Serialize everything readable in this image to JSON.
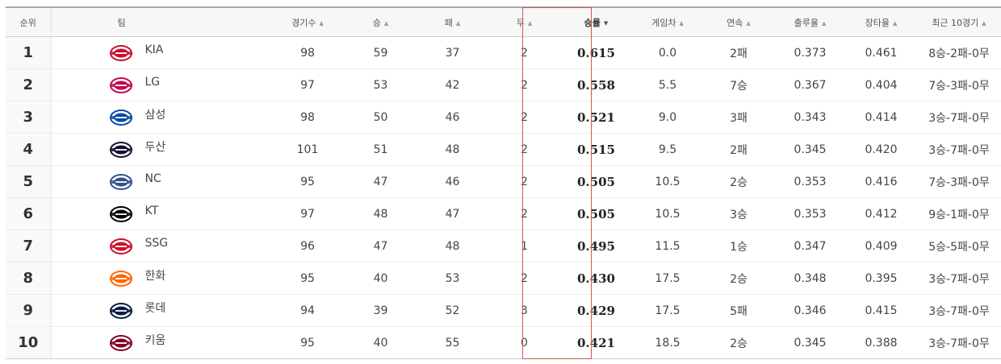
{
  "table": {
    "headers": {
      "rank": "순위",
      "team": "팀",
      "games": "경기수",
      "wins": "승",
      "losses": "패",
      "draws": "무",
      "pct": "승률",
      "gb": "게임차",
      "streak": "연속",
      "obp": "출루율",
      "slg": "장타율",
      "last10": "최근 10경기"
    },
    "sorted_column": "pct",
    "sort_direction": "descending",
    "rows": [
      {
        "rank": "1",
        "team": "KIA",
        "games": "98",
        "wins": "59",
        "losses": "37",
        "draws": "2",
        "pct": "0.615",
        "gb": "0.0",
        "streak": "2패",
        "obp": "0.373",
        "slg": "0.461",
        "last10": "8승-2패-0무",
        "logo_color": "#c8102e"
      },
      {
        "rank": "2",
        "team": "LG",
        "games": "97",
        "wins": "53",
        "losses": "42",
        "draws": "2",
        "pct": "0.558",
        "gb": "5.5",
        "streak": "7승",
        "obp": "0.367",
        "slg": "0.404",
        "last10": "7승-3패-0무",
        "logo_color": "#c30452"
      },
      {
        "rank": "3",
        "team": "삼성",
        "games": "98",
        "wins": "50",
        "losses": "46",
        "draws": "2",
        "pct": "0.521",
        "gb": "9.0",
        "streak": "3패",
        "obp": "0.343",
        "slg": "0.414",
        "last10": "3승-7패-0무",
        "logo_color": "#074ca1"
      },
      {
        "rank": "4",
        "team": "두산",
        "games": "101",
        "wins": "51",
        "losses": "48",
        "draws": "2",
        "pct": "0.515",
        "gb": "9.5",
        "streak": "2패",
        "obp": "0.345",
        "slg": "0.420",
        "last10": "3승-7패-0무",
        "logo_color": "#131230"
      },
      {
        "rank": "5",
        "team": "NC",
        "games": "95",
        "wins": "47",
        "losses": "46",
        "draws": "2",
        "pct": "0.505",
        "gb": "10.5",
        "streak": "2승",
        "obp": "0.353",
        "slg": "0.416",
        "last10": "7승-3패-0무",
        "logo_color": "#315288"
      },
      {
        "rank": "6",
        "team": "KT",
        "games": "97",
        "wins": "48",
        "losses": "47",
        "draws": "2",
        "pct": "0.505",
        "gb": "10.5",
        "streak": "3승",
        "obp": "0.353",
        "slg": "0.412",
        "last10": "9승-1패-0무",
        "logo_color": "#000000"
      },
      {
        "rank": "7",
        "team": "SSG",
        "games": "96",
        "wins": "47",
        "losses": "48",
        "draws": "1",
        "pct": "0.495",
        "gb": "11.5",
        "streak": "1승",
        "obp": "0.347",
        "slg": "0.409",
        "last10": "5승-5패-0무",
        "logo_color": "#ce0e2d"
      },
      {
        "rank": "8",
        "team": "한화",
        "games": "95",
        "wins": "40",
        "losses": "53",
        "draws": "2",
        "pct": "0.430",
        "gb": "17.5",
        "streak": "2승",
        "obp": "0.348",
        "slg": "0.395",
        "last10": "3승-7패-0무",
        "logo_color": "#ff6600"
      },
      {
        "rank": "9",
        "team": "롯데",
        "games": "94",
        "wins": "39",
        "losses": "52",
        "draws": "3",
        "pct": "0.429",
        "gb": "17.5",
        "streak": "5패",
        "obp": "0.346",
        "slg": "0.415",
        "last10": "3승-7패-0무",
        "logo_color": "#041e42"
      },
      {
        "rank": "10",
        "team": "키움",
        "games": "95",
        "wins": "40",
        "losses": "55",
        "draws": "0",
        "pct": "0.421",
        "gb": "18.5",
        "streak": "2승",
        "obp": "0.345",
        "slg": "0.388",
        "last10": "3승-7패-0무",
        "logo_color": "#820024"
      }
    ]
  },
  "icons": {
    "sort_indicator": "sort-arrow-icon",
    "team_emblem": "team-logo-icon"
  },
  "colors": {
    "highlight_border": "#d9534f",
    "header_background": "#f7f7f7",
    "rank_background": "#f9f9f9"
  }
}
